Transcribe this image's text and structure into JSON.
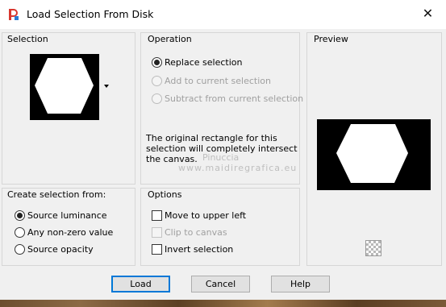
{
  "window": {
    "title": "Load Selection From Disk",
    "close_glyph": "✕"
  },
  "selection_panel": {
    "title": "Selection"
  },
  "operation_panel": {
    "title": "Operation",
    "options": [
      {
        "label": "Replace selection",
        "checked": true,
        "enabled": true
      },
      {
        "label": "Add to current selection",
        "checked": false,
        "enabled": false
      },
      {
        "label": "Subtract from current selection",
        "checked": false,
        "enabled": false
      }
    ],
    "info": "The original rectangle for this selection will completely intersect the canvas."
  },
  "preview_panel": {
    "title": "Preview"
  },
  "create_panel": {
    "title": "Create selection from:",
    "options": [
      {
        "label": "Source luminance",
        "checked": true
      },
      {
        "label": "Any non-zero value",
        "checked": false
      },
      {
        "label": "Source opacity",
        "checked": false
      }
    ]
  },
  "options_panel": {
    "title": "Options",
    "items": [
      {
        "label": "Move to upper left",
        "checked": false,
        "enabled": true
      },
      {
        "label": "Clip to canvas",
        "checked": false,
        "enabled": false
      },
      {
        "label": "Invert selection",
        "checked": false,
        "enabled": true
      }
    ]
  },
  "buttons": {
    "load": "Load",
    "cancel": "Cancel",
    "help": "Help"
  },
  "watermark": {
    "line1": "Pinuccia",
    "line2": "www.maidiregrafica.eu"
  },
  "icons": {
    "app": "psp-app-icon",
    "dropdown": "dropdown-arrow-icon",
    "checker": "transparency-checker-icon"
  }
}
